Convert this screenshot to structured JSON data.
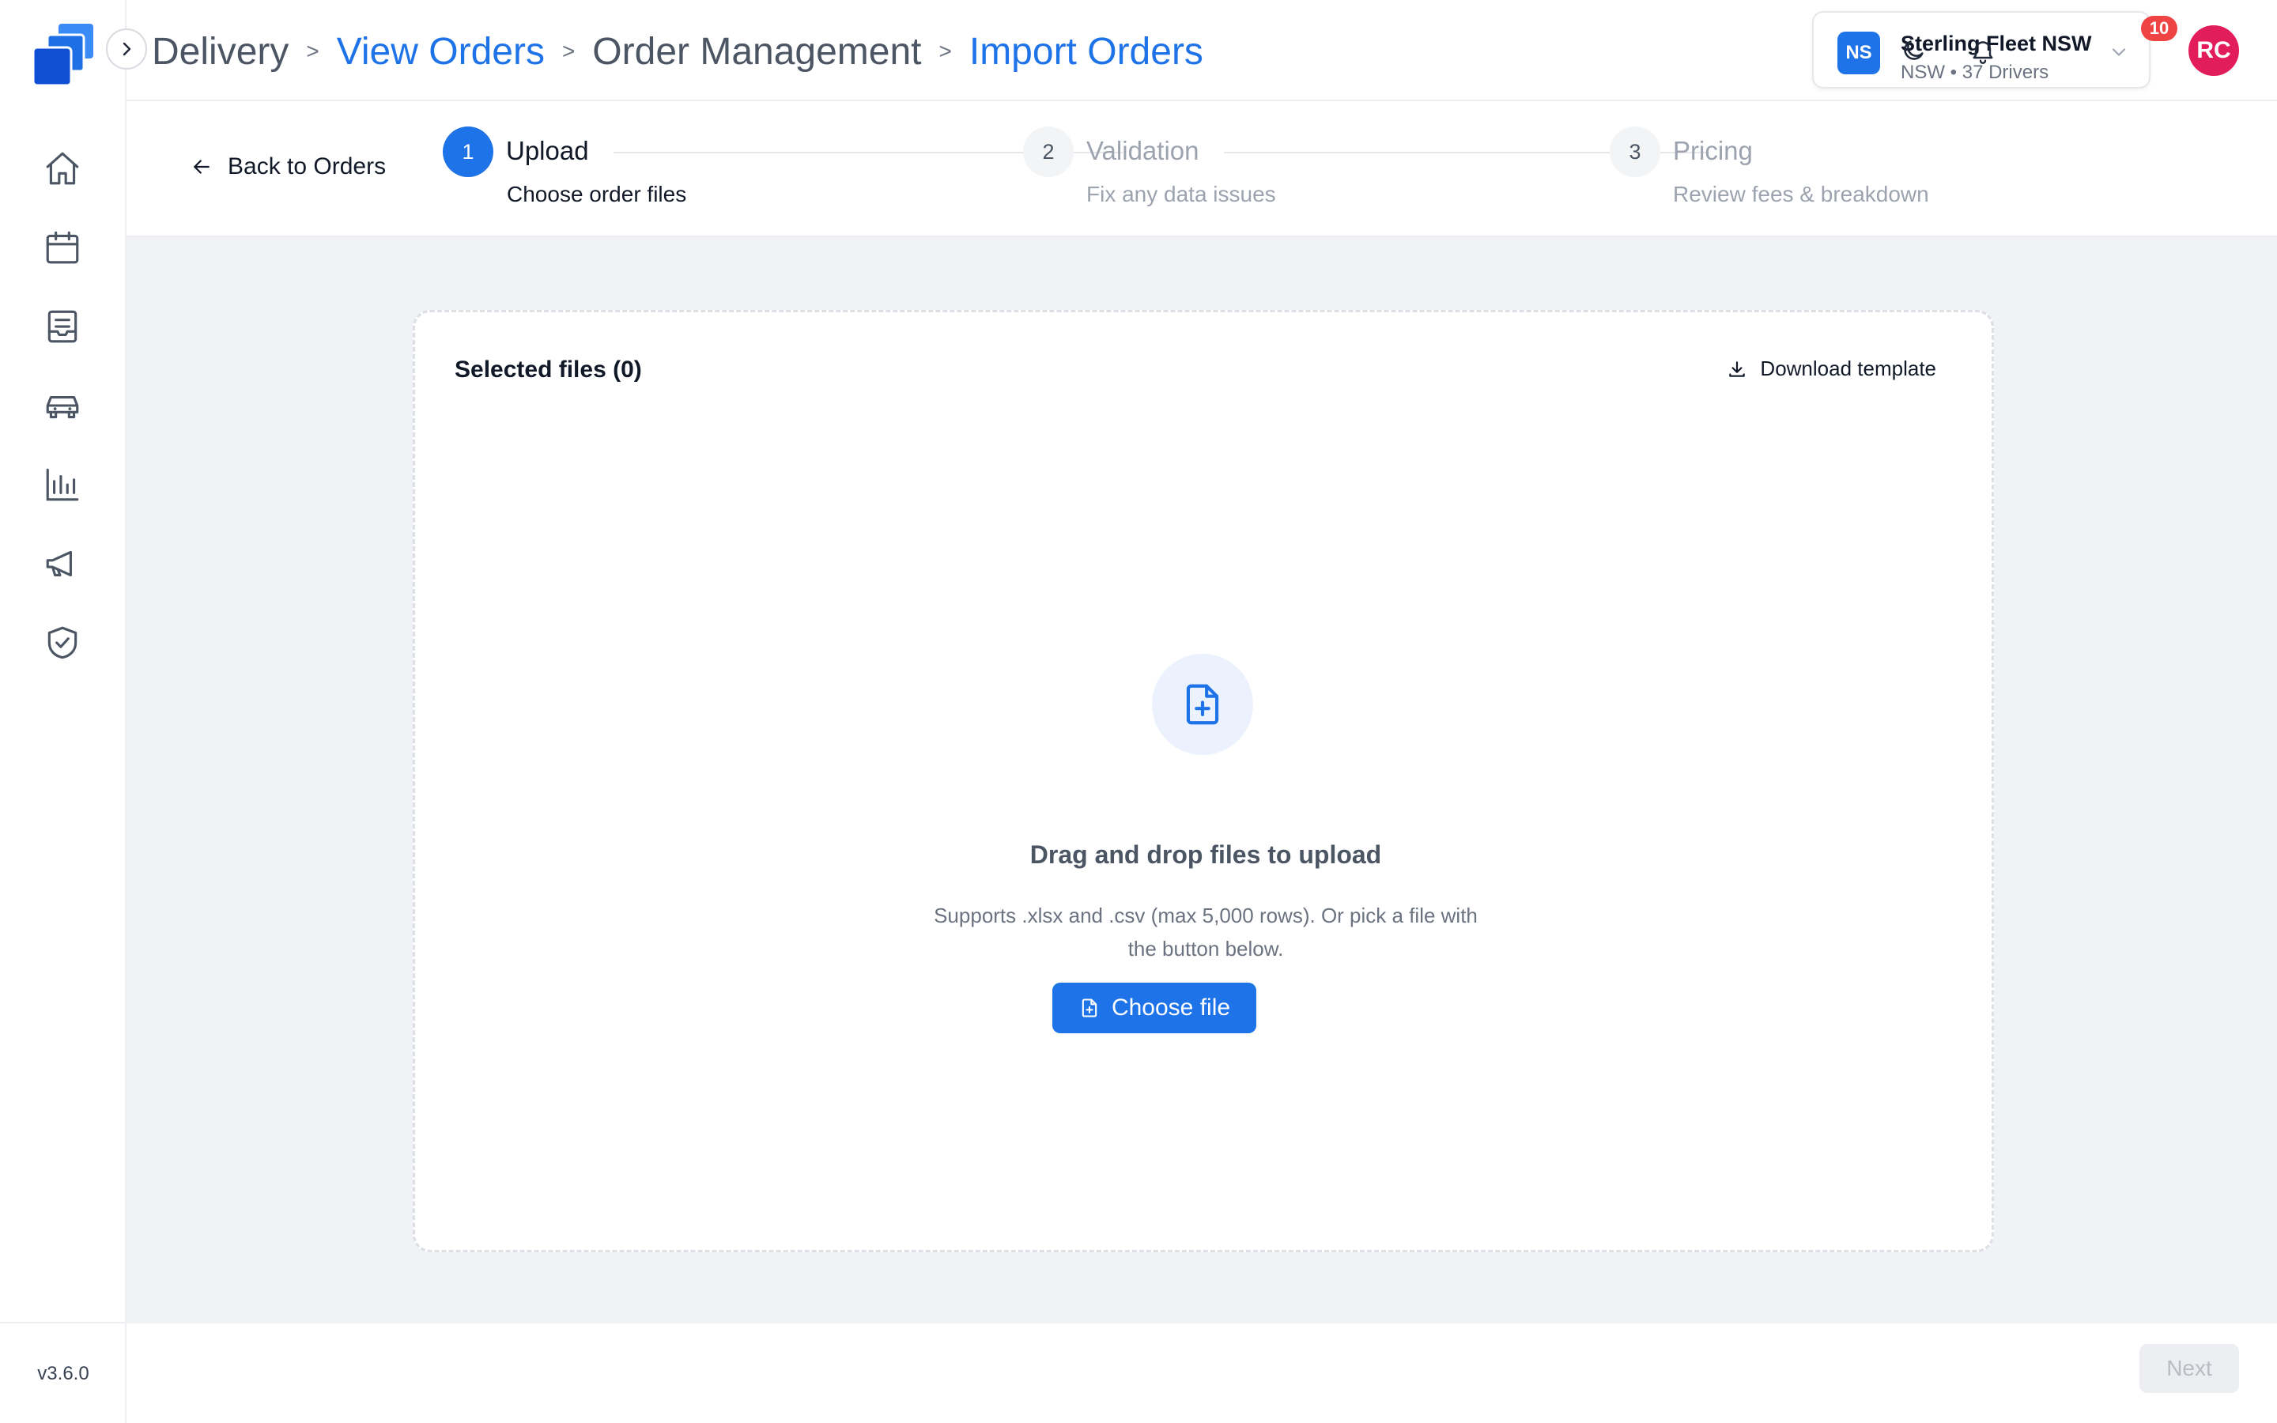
{
  "header": {
    "breadcrumb": [
      "Delivery",
      "View Orders",
      "Order Management",
      "Import Orders"
    ],
    "separator": ">",
    "org": {
      "initials": "NS",
      "name": "Sterling Fleet NSW",
      "details": "NSW • 37 Drivers"
    },
    "notifications_count": "10",
    "avatar_initials": "RC"
  },
  "sidebar": {
    "items": [
      {
        "icon": "home-icon"
      },
      {
        "icon": "calendar-icon"
      },
      {
        "icon": "orders-icon"
      },
      {
        "icon": "vehicle-icon"
      },
      {
        "icon": "analytics-icon"
      },
      {
        "icon": "megaphone-icon"
      },
      {
        "icon": "shield-check-icon"
      }
    ],
    "version": "v3.6.0"
  },
  "stepper": {
    "back_label": "Back to Orders",
    "steps": [
      {
        "number": "1",
        "title": "Upload",
        "subtitle": "Choose order files",
        "state": "active"
      },
      {
        "number": "2",
        "title": "Validation",
        "subtitle": "Fix any data issues",
        "state": "inactive"
      },
      {
        "number": "3",
        "title": "Pricing",
        "subtitle": "Review fees & breakdown",
        "state": "inactive"
      }
    ]
  },
  "upload": {
    "selected_label": "Selected files (0)",
    "download_label": "Download template",
    "drop_title": "Drag and drop files to upload",
    "drop_subtitle": "Supports .xlsx and .csv (max 5,000 rows). Or pick a file with the button below.",
    "choose_label": "Choose file"
  },
  "footer": {
    "next_label": "Next"
  },
  "colors": {
    "accent": "#1e73e8",
    "badge": "#ef4444",
    "avatar": "#e11d5c",
    "background": "#f1f2f5"
  }
}
